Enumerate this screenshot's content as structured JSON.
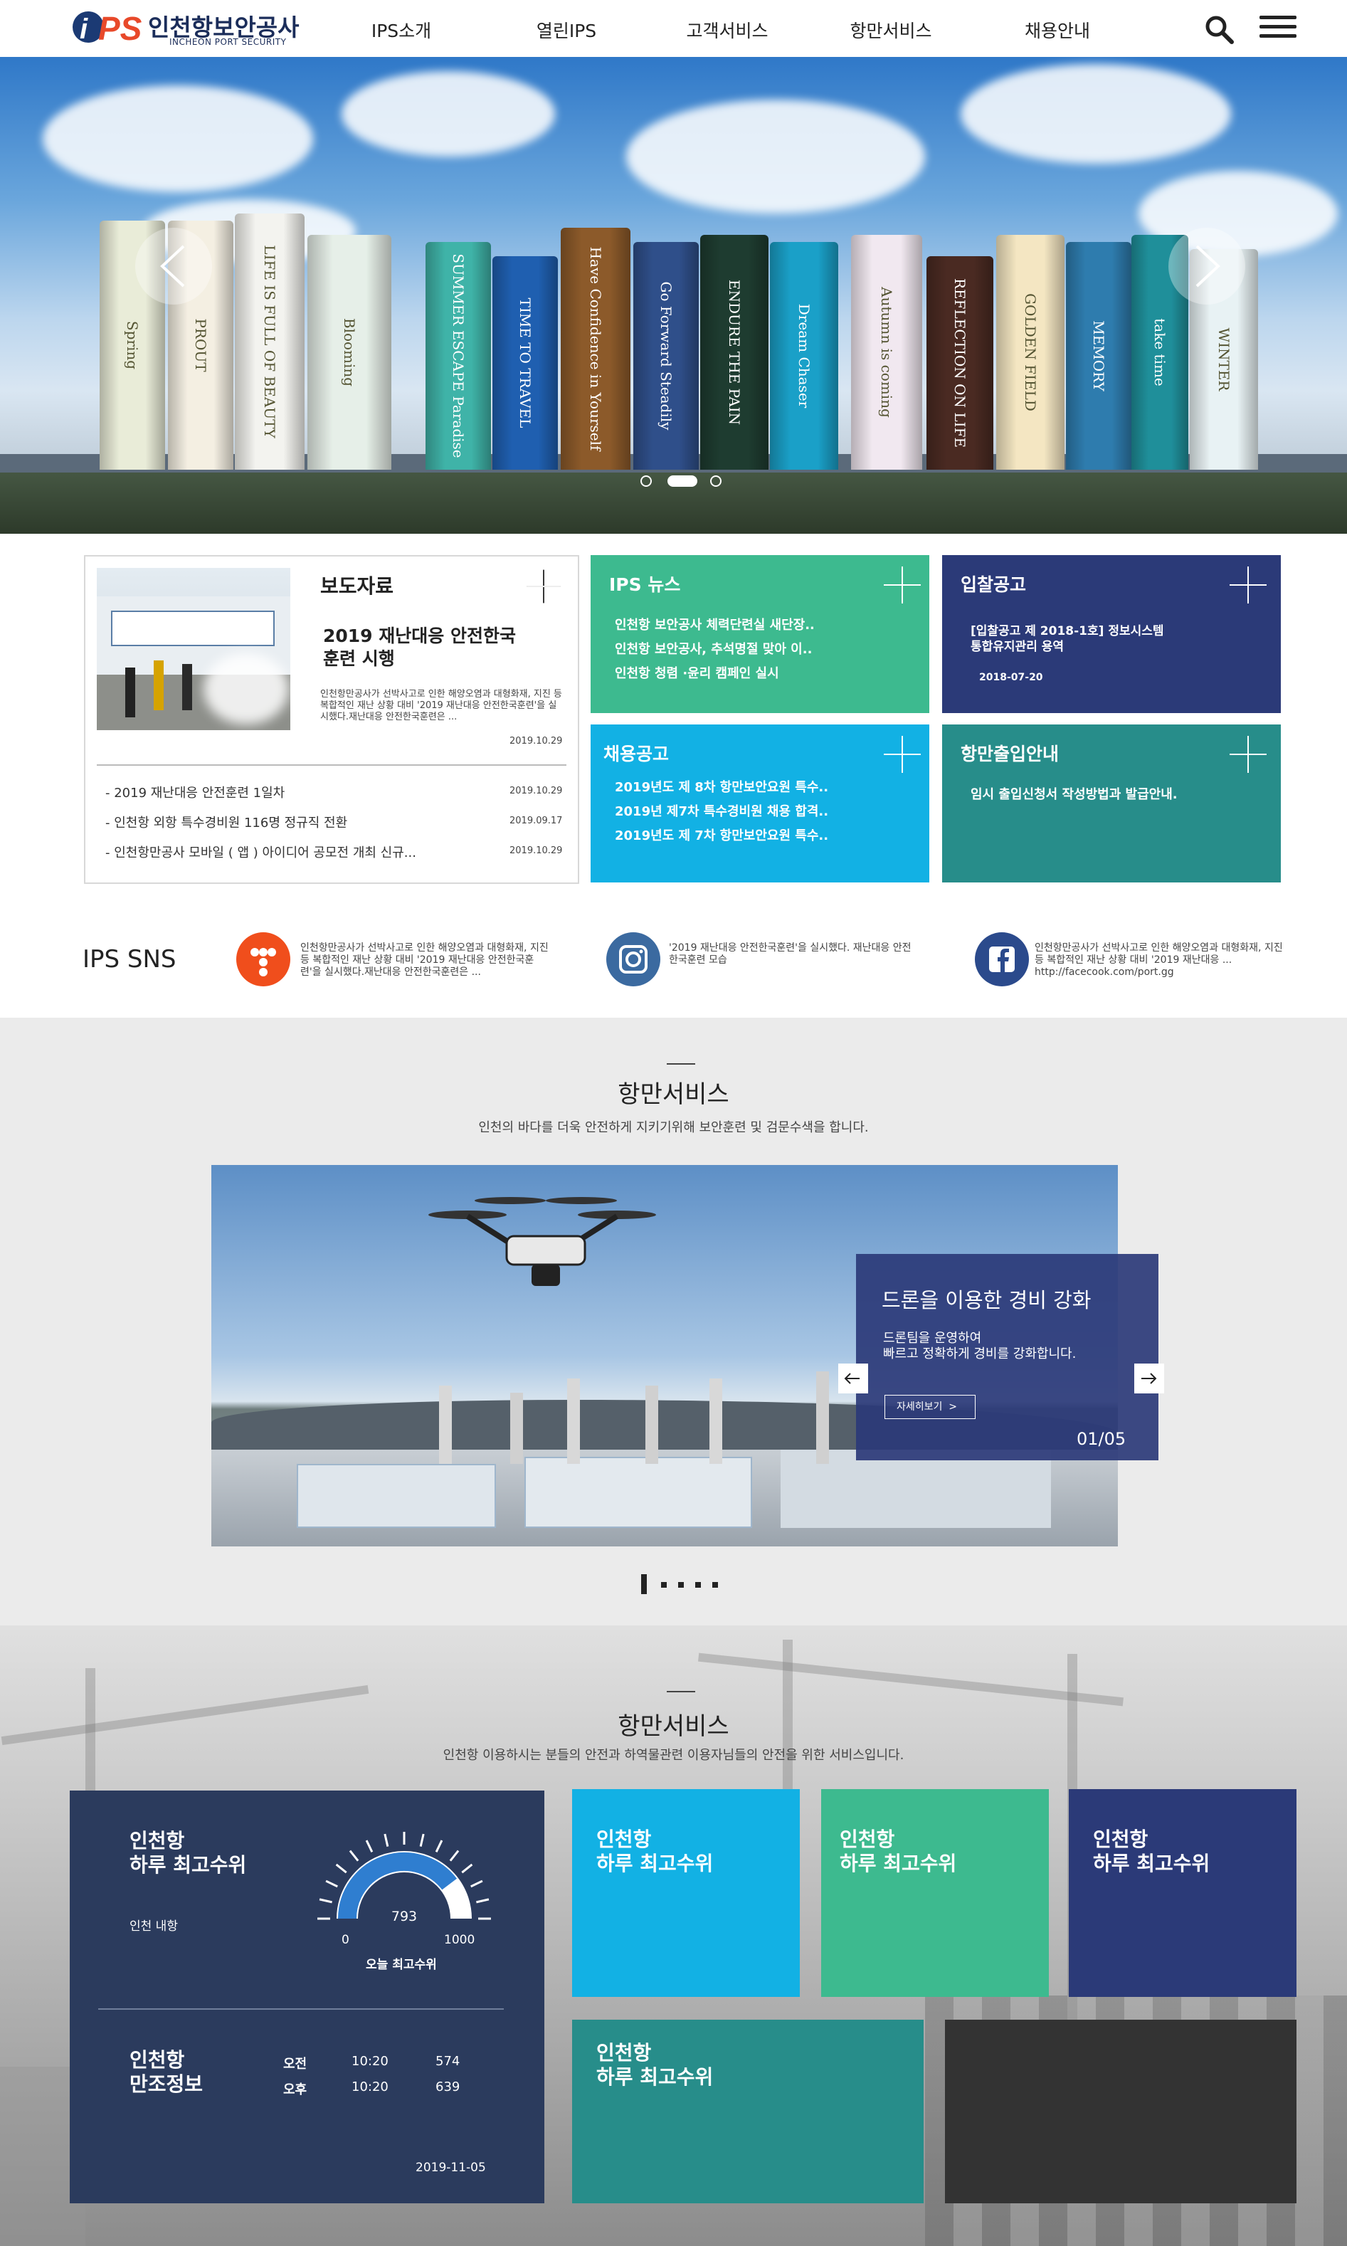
{
  "header": {
    "logo_text": "인천항보안공사",
    "logo_sub": "INCHEON PORT SECURITY",
    "logo_letters": "iPS",
    "nav": [
      "IPS소개",
      "열린IPS",
      "고객서비스",
      "항만서비스",
      "채용안내"
    ],
    "icons": [
      "search-icon",
      "hamburger-menu-icon"
    ]
  },
  "hero": {
    "silo_texts": [
      "Spring",
      "PROUT",
      "LIFE IS FULL OF BEAUTY",
      "Blooming",
      "SUMMER ESCAPE Paradise",
      "TIME TO TRAVEL",
      "Have Confidence in Yourself",
      "Go Forward Steadily",
      "ENDURE THE PAIN",
      "Dream Chaser",
      "Autumn is coming",
      "REFLECTION ON LIFE",
      "GOLDEN FIELD",
      "MEMORY",
      "take time",
      "WINTER"
    ],
    "slide_count": 3,
    "active_slide": 2
  },
  "press": {
    "title": "보도자료",
    "headline_line1": "2019 재난대응 안전한국",
    "headline_line2": "훈련 시행",
    "summary": "인천항만공사가 선박사고로 인한 해양오염과 대형화재, 지진 등 복합적인 재난 상황 대비 '2019 재난대응 안전한국훈련'을 실시했다.재난대응 안전한국훈련은 ...",
    "date": "2019.10.29",
    "items": [
      {
        "text": "- 2019 재난대응 안전훈련 1일차",
        "date": "2019.10.29"
      },
      {
        "text": "- 인천항 외항 특수경비원 116명 정규직 전환",
        "date": "2019.09.17"
      },
      {
        "text": "- 인천항만공사 모바일 ( 앱 ) 아이디어 공모전 개최 신규...",
        "date": "2019.10.29"
      }
    ]
  },
  "ips_news": {
    "title": "IPS 뉴스",
    "color": "#3dba8f",
    "items": [
      "인천항 보안공사 체력단련실 새단장..",
      "인천항 보안공사, 추석명절 맞아 이..",
      "인천항 청렴 ·윤리 캠페인 실시"
    ]
  },
  "bid": {
    "title": "입찰공고",
    "color": "#2b3a78",
    "line1": "[입찰공고 제 2018-1호] 정보시스템",
    "line2": "통합유지관리 용역",
    "date": "2018-07-20"
  },
  "recruit": {
    "title": "채용공고",
    "color": "#12b1e4",
    "items": [
      "2019년도 제 8차 항만보안요원 특수..",
      "2019년 제7차 특수경비원 채용 합격..",
      "2019년도 제 7차 항만보안요원 특수.."
    ]
  },
  "entry": {
    "title": "항만출입안내",
    "color": "#278d8a",
    "line": "임시 출입신청서 작성방법과 발급안내."
  },
  "sns": {
    "title": "IPS SNS",
    "items": [
      {
        "icon": "ips-blog-icon",
        "color": "#f04e1c",
        "text": "인천항만공사가 선박사고로 인한 해양오염과 대형화재, 지진 등 복합적인 재난 상황 대비 '2019 재난대응 안전한국훈련'을 실시했다.재난대응 안전한국훈련은 ..."
      },
      {
        "icon": "instagram-icon",
        "color": "#3b6aa0",
        "text": "'2019 재난대응 안전한국훈련'을 실시했다. 재난대응 안전한국훈련 모습"
      },
      {
        "icon": "facebook-icon",
        "color": "#2b4a8c",
        "text": "인천항만공사가 선박사고로 인한 해양오염과 대형화재, 지진 등 복합적인 재난 상황 대비 '2019 재난대응 ... http://facecook.com/port.gg"
      }
    ]
  },
  "port_service": {
    "title": "항만서비스",
    "subtitle": "인천의 바다를 더욱 안전하게 지키기위해 보안훈련 및 검문수색을 합니다.",
    "slide_title": "드론을 이용한 경비 강화",
    "slide_line1": "드론팀을 운영하여",
    "slide_line2": "빠르고 정확하게 경비를 강화합니다.",
    "more_label": "자세히보기  >",
    "counter": "01/05",
    "slide_count": 5
  },
  "port_service2": {
    "title": "항만서비스",
    "subtitle": "인천항 이용하시는 분들의 안전과 하역물관련 이용자님들의 안전을 위한 서비스입니다.",
    "card": {
      "title_line1": "인천항",
      "title_line2": "하루 최고수위",
      "port_label": "인천 내항",
      "gauge_value": 793,
      "gauge_min": "0",
      "gauge_max": "1000",
      "gauge_label": "오늘 최고수위",
      "tide_title_line1": "인천항",
      "tide_title_line2": "만조정보",
      "tide_rows": [
        {
          "period": "오전",
          "time": "10:20",
          "level": "574"
        },
        {
          "period": "오후",
          "time": "10:20",
          "level": "639"
        }
      ],
      "date": "2019-11-05"
    },
    "tiles": [
      {
        "line1": "인천항",
        "line2": "하루 최고수위",
        "color": "#12b1e4"
      },
      {
        "line1": "인천항",
        "line2": "하루 최고수위",
        "color": "#3dba8f"
      },
      {
        "line1": "인천항",
        "line2": "하루 최고수위",
        "color": "#2b3a78"
      },
      {
        "line1": "인천항",
        "line2": "하루 최고수위",
        "color": "#278d8a"
      }
    ]
  }
}
